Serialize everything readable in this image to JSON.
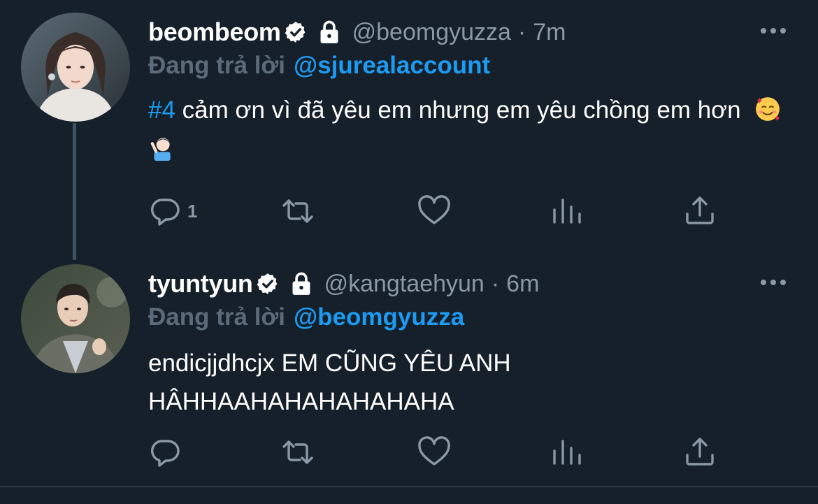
{
  "colors": {
    "background": "#15202b",
    "text": "#ffffff",
    "muted": "#8b98a5",
    "link": "#1d9bf0",
    "thread_line": "#3d5466"
  },
  "tweets": [
    {
      "display_name": "beombeom",
      "handle": "@beomgyuzza",
      "separator": "·",
      "time": "7m",
      "verified": true,
      "protected": true,
      "reply_prefix": "Đang trả lời",
      "reply_to": "@sjurealaccount",
      "hashtag": "#4",
      "text": " cảm ơn vì đã yêu em nhưng em yêu chồng em hơn",
      "emojis": [
        "smiling-face-with-hearts",
        "man-shushing-light-skin"
      ],
      "reply_count": "1"
    },
    {
      "display_name": "tyuntyun",
      "handle": "@kangtaehyun",
      "separator": "·",
      "time": "6m",
      "verified": true,
      "protected": true,
      "reply_prefix": "Đang trả lời",
      "reply_to": "@beomgyuzza",
      "text_line1": "endicjjdhcjx EM CŨNG YÊU ANH",
      "text_line2": "HÂHHAAHAHAHAHAHAHA",
      "reply_count": ""
    }
  ],
  "icons": {
    "reply": "reply-icon",
    "retweet": "retweet-icon",
    "like": "heart-icon",
    "stats": "analytics-icon",
    "share": "share-icon",
    "more": "more-icon",
    "verified": "verified-badge-icon",
    "lock": "lock-icon"
  }
}
